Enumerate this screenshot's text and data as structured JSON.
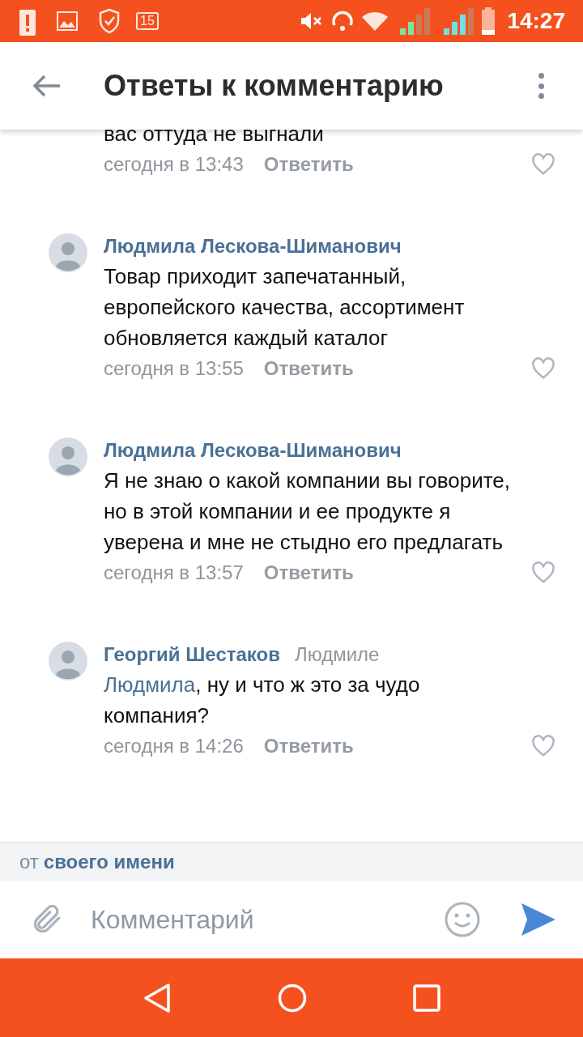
{
  "status_bar": {
    "battery_badge": "15",
    "time": "14:27"
  },
  "header": {
    "title": "Ответы к комментарию"
  },
  "comments": [
    {
      "kind": "partial",
      "text": "вас оттуда не выгнали",
      "time": "сегодня в 13:43",
      "reply": "Ответить",
      "liked": false
    },
    {
      "kind": "full",
      "author": "Людмила Лескова-Шиманович",
      "text": "Товар приходит запечатанный, европейского качества, ассортимент обновляется каждый каталог",
      "time": "сегодня в 13:55",
      "reply": "Ответить",
      "liked": false
    },
    {
      "kind": "full",
      "author": "Людмила Лескова-Шиманович",
      "text": "Я не знаю о какой компании вы говорите, но в этой компании и ее продукте я уверена и мне не стыдно его предлагать",
      "time": "сегодня в 13:57",
      "reply": "Ответить",
      "liked": false
    },
    {
      "kind": "full",
      "author": "Георгий Шестаков",
      "addressee": "Людмиле",
      "mention": "Людмила",
      "text": ", ну и что ж это за чудо компания?",
      "time": "сегодня в 14:26",
      "reply": "Ответить",
      "liked": false
    }
  ],
  "identity": {
    "prefix": "от",
    "name": "своего имени"
  },
  "composer": {
    "placeholder": "Комментарий"
  }
}
